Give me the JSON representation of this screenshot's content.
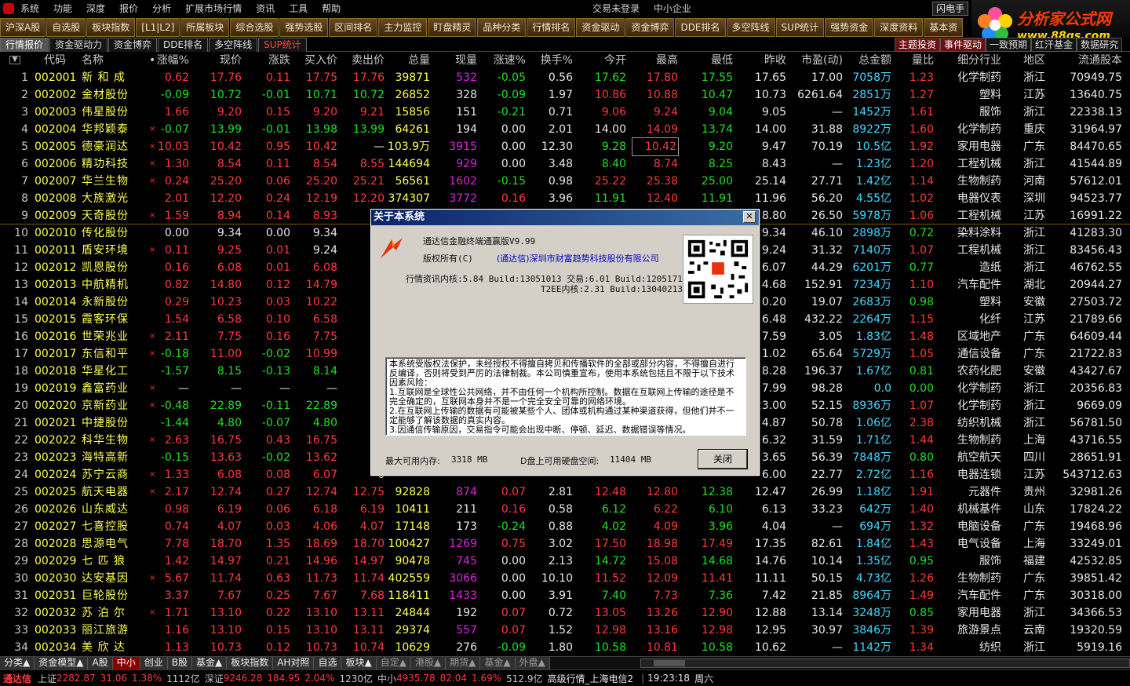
{
  "menu": {
    "items": [
      "系统",
      "功能",
      "深度",
      "报价",
      "分析",
      "扩展市场行情",
      "资讯",
      "工具",
      "帮助"
    ],
    "trade_status": "交易未登录",
    "board": "中小企业",
    "fast_trade": "闪电手"
  },
  "logo": {
    "title": "分析家公式网",
    "url": "www.88gs.com"
  },
  "toolbar": [
    "沪深A股",
    "自选股",
    "板块指数",
    "[L1|L2]",
    "所属板块",
    "综合选股",
    "强势选股",
    "区间排名",
    "主力监控",
    "盯盘精灵",
    "品种分类",
    "行情排名",
    "资金驱动",
    "资金博弈",
    "DDE排名",
    "多空阵线",
    "SUP统计",
    "强势资金",
    "深度资料",
    "基本资"
  ],
  "subtabs": [
    "行情报价",
    "资金驱动力",
    "资金博弈",
    "DDE排名",
    "多空阵线",
    "SUP统计"
  ],
  "right_tabs": [
    "主题投资",
    "事件驱动",
    "一致预期",
    "红汗基金",
    "数据研究"
  ],
  "columns": [
    "代码",
    "名称",
    "•",
    "涨幅%",
    "现价",
    "涨跌",
    "买入价",
    "卖出价",
    "总量",
    "现量",
    "涨速%",
    "换手%",
    "今开",
    "最高",
    "最低",
    "昨收",
    "市盈(动)",
    "总金额",
    "量比",
    "细分行业",
    "地区",
    "流通股本"
  ],
  "rows": [
    [
      "1",
      "002001",
      "新 和 成",
      "",
      "0.62",
      "17.76",
      "0.11",
      "17.75",
      "17.76",
      "39871",
      "532",
      "-0.05",
      "0.56",
      "17.62",
      "17.80",
      "17.55",
      "17.65",
      "17.00",
      "7058万",
      "1.23",
      "化学制药",
      "浙江",
      "70949.75"
    ],
    [
      "2",
      "002002",
      "金材股份",
      "",
      "-0.09",
      "10.72",
      "-0.01",
      "10.71",
      "10.72",
      "26852",
      "328",
      "-0.09",
      "1.97",
      "10.86",
      "10.88",
      "10.47",
      "10.73",
      "6261.64",
      "2851万",
      "1.27",
      "塑料",
      "江苏",
      "13640.75"
    ],
    [
      "3",
      "002003",
      "伟星股份",
      "",
      "1.66",
      "9.20",
      "0.15",
      "9.20",
      "9.21",
      "15856",
      "151",
      "-0.21",
      "0.71",
      "9.06",
      "9.24",
      "9.04",
      "9.05",
      "—",
      "1452万",
      "1.61",
      "服饰",
      "浙江",
      "22338.13"
    ],
    [
      "4",
      "002004",
      "华邦颖泰",
      "×",
      "-0.07",
      "13.99",
      "-0.01",
      "13.98",
      "13.99",
      "64261",
      "194",
      "0.00",
      "2.01",
      "14.00",
      "14.09",
      "13.74",
      "14.00",
      "31.88",
      "8922万",
      "1.60",
      "化学制药",
      "重庆",
      "31964.97"
    ],
    [
      "5",
      "002005",
      "德豪润达",
      "×",
      "10.03",
      "10.42",
      "0.95",
      "10.42",
      "—",
      "103.9万",
      "3915",
      "0.00",
      "12.30",
      "9.28",
      "10.42",
      "9.20",
      "9.47",
      "70.19",
      "10.5亿",
      "1.92",
      "家用电器",
      "广东",
      "84470.65"
    ],
    [
      "6",
      "002006",
      "精功科技",
      "×",
      "1.30",
      "8.54",
      "0.11",
      "8.54",
      "8.55",
      "144694",
      "929",
      "0.00",
      "3.48",
      "8.40",
      "8.74",
      "8.25",
      "8.43",
      "—",
      "1.23亿",
      "1.20",
      "工程机械",
      "浙江",
      "41544.89"
    ],
    [
      "7",
      "002007",
      "华兰生物",
      "×",
      "0.24",
      "25.20",
      "0.06",
      "25.20",
      "25.21",
      "56561",
      "1602",
      "-0.15",
      "0.98",
      "25.22",
      "25.38",
      "25.00",
      "25.14",
      "27.71",
      "1.42亿",
      "1.14",
      "生物制药",
      "河南",
      "57612.01"
    ],
    [
      "8",
      "002008",
      "大族激光",
      "",
      "2.01",
      "12.20",
      "0.24",
      "12.19",
      "12.20",
      "374307",
      "3772",
      "0.16",
      "3.96",
      "11.91",
      "12.40",
      "11.91",
      "11.96",
      "56.20",
      "4.55亿",
      "1.02",
      "电器仪表",
      "深圳",
      "94523.77"
    ],
    [
      "9",
      "002009",
      "天奇股份",
      "×",
      "1.59",
      "8.94",
      "0.14",
      "8.93",
      "8",
      "",
      "",
      "",
      "",
      "",
      "",
      "",
      "8.80",
      "26.50",
      "5978万",
      "1.06",
      "工程机械",
      "江苏",
      "16991.22"
    ],
    [
      "10",
      "002010",
      "传化股份",
      "",
      "0.00",
      "9.34",
      "0.00",
      "9.34",
      "9",
      "",
      "",
      "",
      "",
      "",
      "",
      "",
      "9.34",
      "46.10",
      "2898万",
      "0.72",
      "染料涂料",
      "浙江",
      "41283.30"
    ],
    [
      "11",
      "002011",
      "盾安环境",
      "×",
      "0.11",
      "9.25",
      "0.01",
      "9.24",
      "9",
      "",
      "",
      "",
      "",
      "",
      "",
      "",
      "9.24",
      "31.32",
      "7140万",
      "1.07",
      "工程机械",
      "浙江",
      "83456.43"
    ],
    [
      "12",
      "002012",
      "凯恩股份",
      "",
      "0.16",
      "6.08",
      "0.01",
      "6.08",
      "6",
      "",
      "",
      "",
      "",
      "",
      "",
      "",
      "6.07",
      "44.29",
      "6201万",
      "0.77",
      "造纸",
      "浙江",
      "46762.55"
    ],
    [
      "13",
      "002013",
      "中航精机",
      "",
      "0.82",
      "14.80",
      "0.12",
      "14.79",
      "14",
      "",
      "",
      "",
      "",
      "",
      "",
      "",
      "4.68",
      "152.91",
      "7234万",
      "1.10",
      "汽车配件",
      "湖北",
      "20944.27"
    ],
    [
      "14",
      "002014",
      "永新股份",
      "",
      "0.29",
      "10.23",
      "0.03",
      "10.22",
      "10",
      "",
      "",
      "",
      "",
      "",
      "",
      "",
      "0.20",
      "19.07",
      "2683万",
      "0.98",
      "塑料",
      "安徽",
      "27503.72"
    ],
    [
      "15",
      "002015",
      "霞客环保",
      "",
      "1.54",
      "6.58",
      "0.10",
      "6.58",
      "6",
      "",
      "",
      "",
      "",
      "",
      "",
      "",
      "6.48",
      "432.22",
      "2264万",
      "1.15",
      "化纤",
      "江苏",
      "21789.66"
    ],
    [
      "16",
      "002016",
      "世荣兆业",
      "×",
      "2.11",
      "7.75",
      "0.16",
      "7.75",
      "7",
      "",
      "",
      "",
      "",
      "",
      "",
      "",
      "7.59",
      "3.05",
      "1.83亿",
      "1.48",
      "区域地产",
      "广东",
      "64609.44"
    ],
    [
      "17",
      "002017",
      "东信和平",
      "×",
      "-0.18",
      "11.00",
      "-0.02",
      "10.99",
      "11",
      "",
      "",
      "",
      "",
      "",
      "",
      "",
      "1.02",
      "65.64",
      "5729万",
      "1.05",
      "通信设备",
      "广东",
      "21722.83"
    ],
    [
      "18",
      "002018",
      "华星化工",
      "",
      "-1.57",
      "8.15",
      "-0.13",
      "8.14",
      "8",
      "",
      "",
      "",
      "",
      "",
      "",
      "",
      "8.28",
      "196.37",
      "1.67亿",
      "0.81",
      "农药化肥",
      "安徽",
      "43427.67"
    ],
    [
      "19",
      "002019",
      "鑫富药业",
      "×",
      "—",
      "—",
      "—",
      "—",
      "",
      "",
      "",
      "",
      "",
      "",
      "",
      "",
      "7.99",
      "98.28",
      "0.0",
      "0.00",
      "化学制药",
      "浙江",
      "20356.83"
    ],
    [
      "20",
      "002020",
      "京新药业",
      "×",
      "-0.48",
      "22.89",
      "-0.11",
      "22.89",
      "22",
      "",
      "",
      "",
      "",
      "",
      "",
      "",
      "23.00",
      "52.15",
      "8936万",
      "1.07",
      "化学制药",
      "浙江",
      "9669.09"
    ],
    [
      "21",
      "002021",
      "中捷股份",
      "",
      "-1.44",
      "4.80",
      "-0.07",
      "4.80",
      "4",
      "",
      "",
      "",
      "",
      "",
      "",
      "",
      "4.87",
      "50.78",
      "1.06亿",
      "2.38",
      "纺织机械",
      "浙江",
      "56781.50"
    ],
    [
      "22",
      "002022",
      "科华生物",
      "×",
      "2.63",
      "16.75",
      "0.43",
      "16.75",
      "16",
      "",
      "",
      "",
      "",
      "",
      "",
      "",
      "6.32",
      "31.59",
      "1.71亿",
      "1.44",
      "生物制药",
      "上海",
      "43716.55"
    ],
    [
      "23",
      "002023",
      "海特高新",
      "",
      "-0.15",
      "13.63",
      "-0.02",
      "13.62",
      "13",
      "",
      "",
      "",
      "",
      "",
      "",
      "",
      "3.65",
      "56.39",
      "7848万",
      "0.80",
      "航空航天",
      "四川",
      "28651.91"
    ],
    [
      "24",
      "002024",
      "苏宁云商",
      "×",
      "1.33",
      "6.08",
      "0.08",
      "6.07",
      "6",
      "",
      "",
      "",
      "",
      "",
      "",
      "",
      "6.00",
      "22.77",
      "2.72亿",
      "1.16",
      "电器连锁",
      "江苏",
      "543712.63"
    ],
    [
      "25",
      "002025",
      "航天电器",
      "×",
      "2.17",
      "12.74",
      "0.27",
      "12.74",
      "12.75",
      "92828",
      "874",
      "0.07",
      "2.81",
      "12.48",
      "12.80",
      "12.38",
      "12.47",
      "26.99",
      "1.18亿",
      "1.91",
      "元器件",
      "贵州",
      "32981.26"
    ],
    [
      "26",
      "002026",
      "山东威达",
      "",
      "0.98",
      "6.19",
      "0.06",
      "6.18",
      "6.19",
      "10411",
      "211",
      "0.16",
      "0.58",
      "6.12",
      "6.22",
      "6.10",
      "6.13",
      "33.23",
      "642万",
      "1.40",
      "机械基件",
      "山东",
      "17824.22"
    ],
    [
      "27",
      "002027",
      "七喜控股",
      "",
      "0.74",
      "4.07",
      "0.03",
      "4.06",
      "4.07",
      "17148",
      "173",
      "-0.24",
      "0.88",
      "4.02",
      "4.09",
      "3.96",
      "4.04",
      "—",
      "694万",
      "1.32",
      "电脑设备",
      "广东",
      "19468.96"
    ],
    [
      "28",
      "002028",
      "思源电气",
      "",
      "7.78",
      "18.70",
      "1.35",
      "18.69",
      "18.70",
      "100427",
      "1269",
      "0.75",
      "3.02",
      "17.50",
      "18.98",
      "17.49",
      "17.35",
      "82.61",
      "1.84亿",
      "1.43",
      "电气设备",
      "上海",
      "33249.01"
    ],
    [
      "29",
      "002029",
      "七 匹 狼",
      "",
      "1.42",
      "14.97",
      "0.21",
      "14.96",
      "14.97",
      "90478",
      "745",
      "0.00",
      "2.13",
      "14.72",
      "15.08",
      "14.68",
      "14.76",
      "10.14",
      "1.35亿",
      "0.95",
      "服饰",
      "福建",
      "42532.85"
    ],
    [
      "30",
      "002030",
      "达安基因",
      "×",
      "5.67",
      "11.74",
      "0.63",
      "11.73",
      "11.74",
      "402559",
      "3066",
      "0.00",
      "10.10",
      "11.52",
      "12.09",
      "11.41",
      "11.11",
      "50.15",
      "4.73亿",
      "1.26",
      "生物制药",
      "广东",
      "39851.42"
    ],
    [
      "31",
      "002031",
      "巨轮股份",
      "",
      "3.37",
      "7.67",
      "0.25",
      "7.67",
      "7.68",
      "118411",
      "1433",
      "0.00",
      "3.91",
      "7.40",
      "7.73",
      "7.36",
      "7.42",
      "21.85",
      "8964万",
      "1.49",
      "汽车配件",
      "广东",
      "30318.00"
    ],
    [
      "32",
      "002032",
      "苏 泊 尔",
      "×",
      "1.71",
      "13.10",
      "0.22",
      "13.10",
      "13.11",
      "24844",
      "192",
      "0.07",
      "0.72",
      "13.05",
      "13.26",
      "12.90",
      "12.88",
      "13.14",
      "3248万",
      "0.85",
      "家用电器",
      "浙江",
      "34366.53"
    ],
    [
      "33",
      "002033",
      "丽江旅游",
      "",
      "1.16",
      "13.10",
      "0.15",
      "13.10",
      "13.11",
      "29374",
      "557",
      "0.07",
      "1.52",
      "12.98",
      "13.16",
      "12.98",
      "12.95",
      "30.97",
      "3846万",
      "1.39",
      "旅游景点",
      "云南",
      "19320.59"
    ],
    [
      "34",
      "002034",
      "美 欣 达",
      "",
      "1.13",
      "10.73",
      "0.12",
      "10.73",
      "10.74",
      "10629",
      "276",
      "-0.09",
      "1.80",
      "10.58",
      "10.81",
      "10.58",
      "10.62",
      "—",
      "1142万",
      "1.34",
      "纺织",
      "浙江",
      "5919.16"
    ]
  ],
  "bottom_tabs": [
    "分类▲",
    "资金模型▲",
    "A股",
    "中小",
    "创业",
    "B股",
    "基金▲",
    "板块指数",
    "AH对照",
    "自选",
    "板块▲",
    "自定▲",
    "港股▲",
    "期货▲",
    "基金▲",
    "外盘▲"
  ],
  "status": {
    "brand": "通达信",
    "sh_label": "上证",
    "sh_value": "2282.87",
    "sh_change": "31.06",
    "sh_pct": "1.38%",
    "sh_amount": "1112亿",
    "sz_label": "深证",
    "sz_value": "9246.28",
    "sz_change": "184.95",
    "sz_pct": "2.04%",
    "sz_amount": "1230亿",
    "zx_label": "中小",
    "zx_value": "4935.78",
    "zx_change": "82.04",
    "zx_pct": "1.69%",
    "zx_amount": "512.9亿",
    "server": "高级行情_上海电信2",
    "time": "19:23:18",
    "weekday": "周六"
  },
  "dialog": {
    "title": "关于本系统",
    "close_x": "✕",
    "product": "通达信金融终端通赢版V9.99",
    "copyright_label": "版权所有(C)",
    "company": "(通达信)深圳市财富趋势科技股份有限公司",
    "kernel_line1": "行情资讯内核:5.84 Build:13051013 交易:6.01 Build:12051710",
    "kernel_line2": "T2EE内核:2.31 Build:13040213",
    "notice": [
      "本系统受版权法保护，未经授权不得擅自拷贝和传播软件的全部或部分内容，不得擅自进行反编译，否则将受到严厉的法律制裁。本公司慎重宣布，使用本系统包括且不限于以下技术因素风险：",
      "1.互联网是全球性公共网络，并不由任何一个机构所控制。数据在互联网上传输的途径是不完全确定的，互联网本身并不是一个完全安全可靠的网络环境。",
      "2.在互联网上传输的数据有可能被某些个人、团体或机构通过某种渠道获得，但他们并不一定能够了解该数据的真实内容。",
      "3.因通信传输原因，交易指令可能会出现中断、停顿、延迟、数据错误等情况。"
    ],
    "memory_label": "最大可用内存:",
    "memory_value": "3318 MB",
    "disk_label": "D盘上可用硬盘空间:",
    "disk_value": "11404 MB",
    "close_button": "关闭"
  }
}
